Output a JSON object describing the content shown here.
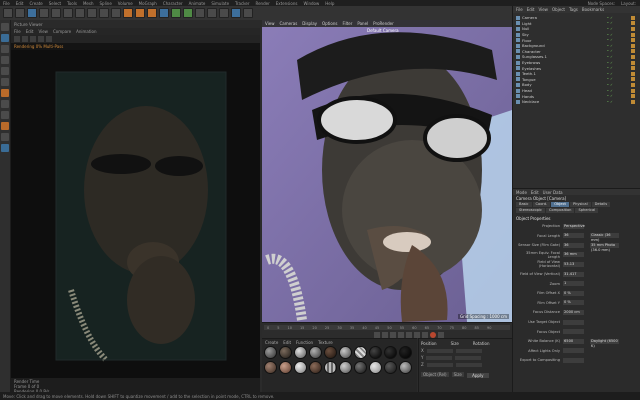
{
  "app": {
    "menu": [
      "File",
      "Edit",
      "Create",
      "Select",
      "Tools",
      "Mesh",
      "Spline",
      "Volume",
      "MoGraph",
      "Character",
      "Animate",
      "Simulate",
      "Tracker",
      "Render",
      "Extensions",
      "Window",
      "Help"
    ],
    "layout_labels": [
      "Node Spaces:",
      "Layout:"
    ]
  },
  "render_window": {
    "title": "Picture Viewer",
    "menu": [
      "File",
      "Edit",
      "View",
      "Compare",
      "Animation"
    ],
    "status": "Rendering 0%   Multi-Pass",
    "footer_lines": [
      "Render Time",
      "Frame 0 of 0",
      "Rendering   0   0 B/s"
    ]
  },
  "viewport": {
    "menu": [
      "View",
      "Cameras",
      "Display",
      "Options",
      "Filter",
      "Panel",
      "ProRender"
    ],
    "camera_label": "Default Camera",
    "grid_label": "Grid Spacing : 1000 cm"
  },
  "timeline": {
    "ticks": [
      "0",
      "5",
      "10",
      "15",
      "20",
      "25",
      "30",
      "35",
      "40",
      "45",
      "50",
      "55",
      "60",
      "65",
      "70",
      "75",
      "80",
      "85",
      "90"
    ]
  },
  "materials": {
    "menu": [
      "Create",
      "Edit",
      "Function",
      "Texture"
    ]
  },
  "coordinates": {
    "headers": [
      "Position",
      "Size",
      "Rotation"
    ],
    "axes": [
      "X",
      "Y",
      "Z"
    ],
    "apply_label": "Apply",
    "mode_options": [
      "Object (Rel)",
      "Size"
    ]
  },
  "object_manager": {
    "menu": [
      "File",
      "Edit",
      "View",
      "Object",
      "Tags",
      "Bookmarks"
    ],
    "objects": [
      "Camera",
      "Light",
      "Null",
      "Sky",
      "Floor",
      "Background",
      "Character",
      "Sunglasses.1",
      "Eyebrows",
      "Eyelashes",
      "Teeth.1",
      "Tongue",
      "Body",
      "Head",
      "Hands",
      "Necklace"
    ]
  },
  "attributes": {
    "menu": [
      "Mode",
      "Edit",
      "User Data"
    ],
    "object_name": "Camera Object [Camera]",
    "tabs": [
      "Basic",
      "Coord.",
      "Object",
      "Physical",
      "Details",
      "Stereoscopic",
      "Composition",
      "Spherical"
    ],
    "section": "Object Properties",
    "props": [
      {
        "k": "Projection",
        "v": "Perspective"
      },
      {
        "k": "Focal Length",
        "v": "36",
        "v2": "Classic (36 mm)"
      },
      {
        "k": "Sensor Size (Film Gate)",
        "v": "36",
        "v2": "35 mm Photo (36.0 mm)"
      },
      {
        "k": "35mm Equiv. Focal Length",
        "v": "36 mm"
      },
      {
        "k": "Field of View (Horizontal)",
        "v": "53.13"
      },
      {
        "k": "Field of View (Vertical)",
        "v": "31.417"
      },
      {
        "k": "Zoom",
        "v": "1"
      },
      {
        "k": "Film Offset X",
        "v": "0 %"
      },
      {
        "k": "Film Offset Y",
        "v": "0 %"
      },
      {
        "k": "Focus Distance",
        "v": "2000 cm"
      },
      {
        "k": "Use Target Object",
        "v": ""
      },
      {
        "k": "Focus Object",
        "v": ""
      },
      {
        "k": "White Balance (K)",
        "v": "6500",
        "v2": "Daylight (6500 K)"
      },
      {
        "k": "Affect Lights Only",
        "v": ""
      },
      {
        "k": "Export to Compositing",
        "v": ""
      }
    ]
  },
  "status_bar": "Move: Click and drag to move elements. Hold down SHIFT to quantize movement / add to the selection in point mode, CTRL to remove."
}
